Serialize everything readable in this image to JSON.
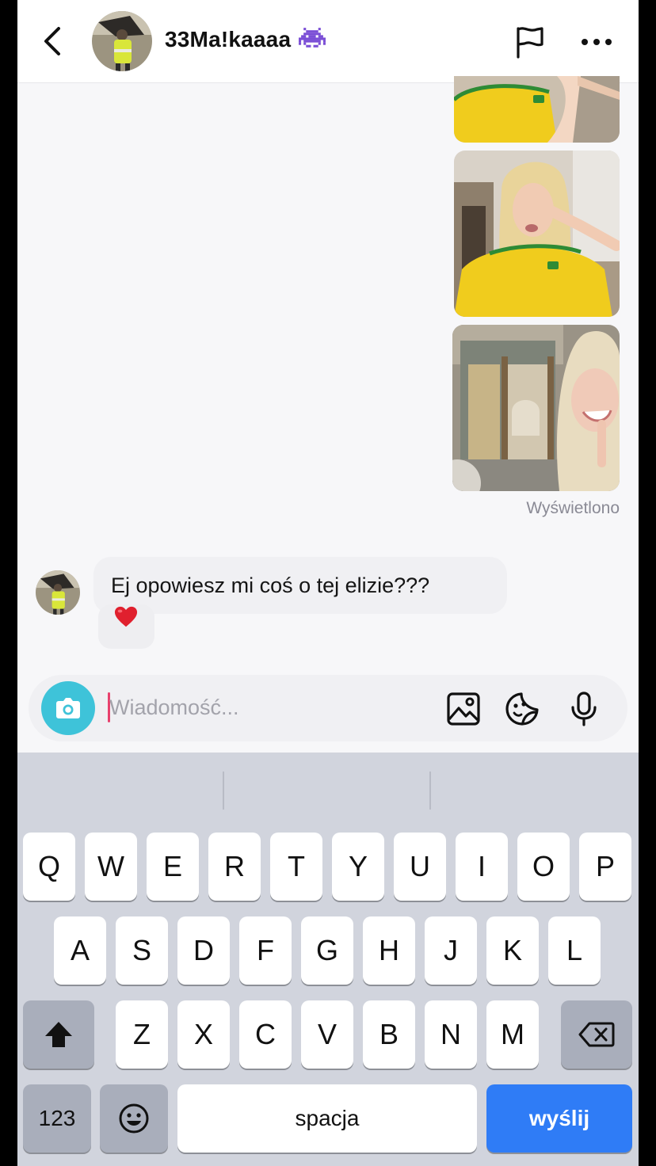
{
  "header": {
    "username": "33Ma!kaaaa",
    "icons": {
      "back": "chevron-left-icon",
      "badge": "alien-monster-icon",
      "report": "flag-icon",
      "menu": "more-horizontal-icon"
    }
  },
  "messages": {
    "outgoing_media_status": "Wyświetlono",
    "incoming_text": "Ej opowiesz mi coś o tej elizie???",
    "reaction": "heart"
  },
  "composer": {
    "placeholder": "Wiadomość...",
    "icons": [
      "camera-icon",
      "image-icon",
      "sticker-icon",
      "microphone-icon"
    ]
  },
  "keyboard": {
    "row1": [
      "Q",
      "W",
      "E",
      "R",
      "T",
      "Y",
      "U",
      "I",
      "O",
      "P"
    ],
    "row2": [
      "A",
      "S",
      "D",
      "F",
      "G",
      "H",
      "J",
      "K",
      "L"
    ],
    "row3": [
      "Z",
      "X",
      "C",
      "V",
      "B",
      "N",
      "M"
    ],
    "numbers_label": "123",
    "space_label": "spacja",
    "send_label": "wyślij"
  },
  "colors": {
    "accent_camera": "#3ec3d9",
    "send_key": "#2f7cf6",
    "caret": "#e8416d",
    "heart": "#e0202e"
  }
}
